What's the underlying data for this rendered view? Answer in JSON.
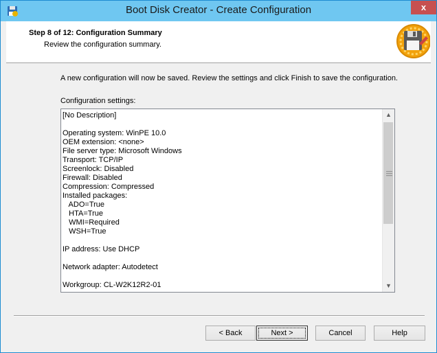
{
  "window": {
    "title": "Boot Disk Creator - Create Configuration",
    "close_label": "x"
  },
  "header": {
    "step_title": "Step 8 of 12: Configuration Summary",
    "step_subtitle": "Review the configuration summary."
  },
  "main": {
    "intro_text": "A new configuration will now be saved.  Review the settings and click Finish to save the configuration.",
    "settings_label": "Configuration settings:",
    "settings_lines": [
      "[No Description]",
      "",
      "Operating system: WinPE 10.0",
      "OEM extension: <none>",
      "File server type: Microsoft Windows",
      "Transport: TCP/IP",
      "Screenlock: Disabled",
      "Firewall: Disabled",
      "Compression: Compressed",
      "Installed packages:",
      "   ADO=True",
      "   HTA=True",
      "   WMI=Required",
      "   WSH=True",
      "",
      "IP address: Use DHCP",
      "",
      "Network adapter: Autodetect",
      "",
      "Workgroup: CL-W2K12R2-01"
    ]
  },
  "buttons": {
    "back": "< Back",
    "next": "Next >",
    "cancel": "Cancel",
    "help": "Help"
  },
  "colors": {
    "titlebar": "#6fc7f1",
    "close": "#c75050",
    "border": "#1c8bd1"
  }
}
